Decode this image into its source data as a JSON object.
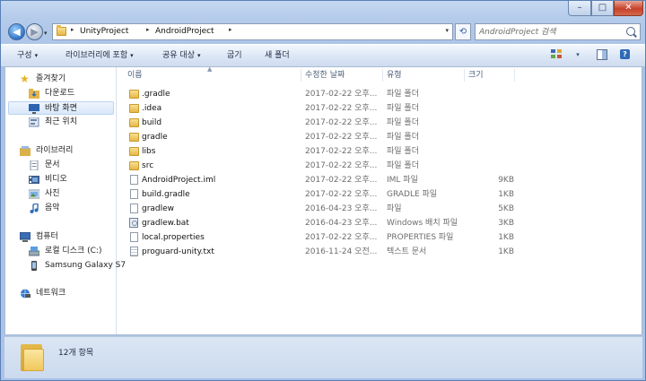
{
  "window": {
    "controls": {
      "minimize": "–",
      "maximize": "□",
      "close": "✕"
    }
  },
  "nav": {
    "back": "◀",
    "forward": "▶",
    "dropdown": "▾"
  },
  "address": {
    "crumbs": [
      "UnityProject",
      "AndroidProject"
    ],
    "separator": "▸",
    "dropdown": "▾",
    "refresh": "⟲"
  },
  "search": {
    "placeholder": "AndroidProject 검색"
  },
  "toolbar": {
    "organize": "구성",
    "include_in_library": "라이브러리에 포함",
    "share_with": "공유 대상",
    "burn": "굽기",
    "new_folder": "새 폴더",
    "caret": "▾",
    "view_caret": "▾",
    "help": "?"
  },
  "sidebar": {
    "favorites": {
      "label": "즐겨찾기",
      "items": [
        "다운로드",
        "바탕 화면",
        "최근 위치"
      ]
    },
    "libraries": {
      "label": "라이브러리",
      "items": [
        "문서",
        "비디오",
        "사진",
        "음악"
      ]
    },
    "computer": {
      "label": "컴퓨터",
      "items": [
        "로컬 디스크 (C:)",
        "Samsung Galaxy S7"
      ]
    },
    "network": {
      "label": "네트워크"
    }
  },
  "columns": {
    "name": "이름",
    "date": "수정한 날짜",
    "type": "유형",
    "size": "크기",
    "sort_arrow": "▲"
  },
  "files": [
    {
      "name": ".gradle",
      "date": "2017-02-22 오후...",
      "type": "파일 폴더",
      "size": "",
      "icon": "folder"
    },
    {
      "name": ".idea",
      "date": "2017-02-22 오후...",
      "type": "파일 폴더",
      "size": "",
      "icon": "folder"
    },
    {
      "name": "build",
      "date": "2017-02-22 오후...",
      "type": "파일 폴더",
      "size": "",
      "icon": "folder"
    },
    {
      "name": "gradle",
      "date": "2017-02-22 오후...",
      "type": "파일 폴더",
      "size": "",
      "icon": "folder"
    },
    {
      "name": "libs",
      "date": "2017-02-22 오후...",
      "type": "파일 폴더",
      "size": "",
      "icon": "folder"
    },
    {
      "name": "src",
      "date": "2017-02-22 오후...",
      "type": "파일 폴더",
      "size": "",
      "icon": "folder"
    },
    {
      "name": "AndroidProject.iml",
      "date": "2017-02-22 오후...",
      "type": "IML 파일",
      "size": "9KB",
      "icon": "file"
    },
    {
      "name": "build.gradle",
      "date": "2017-02-22 오후...",
      "type": "GRADLE 파일",
      "size": "1KB",
      "icon": "file"
    },
    {
      "name": "gradlew",
      "date": "2016-04-23 오후...",
      "type": "파일",
      "size": "5KB",
      "icon": "file"
    },
    {
      "name": "gradlew.bat",
      "date": "2016-04-23 오후...",
      "type": "Windows 배치 파일",
      "size": "3KB",
      "icon": "bat"
    },
    {
      "name": "local.properties",
      "date": "2017-02-22 오후...",
      "type": "PROPERTIES 파일",
      "size": "1KB",
      "icon": "file"
    },
    {
      "name": "proguard-unity.txt",
      "date": "2016-11-24 오전...",
      "type": "텍스트 문서",
      "size": "1KB",
      "icon": "text"
    }
  ],
  "status": {
    "item_count": "12개 항목"
  }
}
